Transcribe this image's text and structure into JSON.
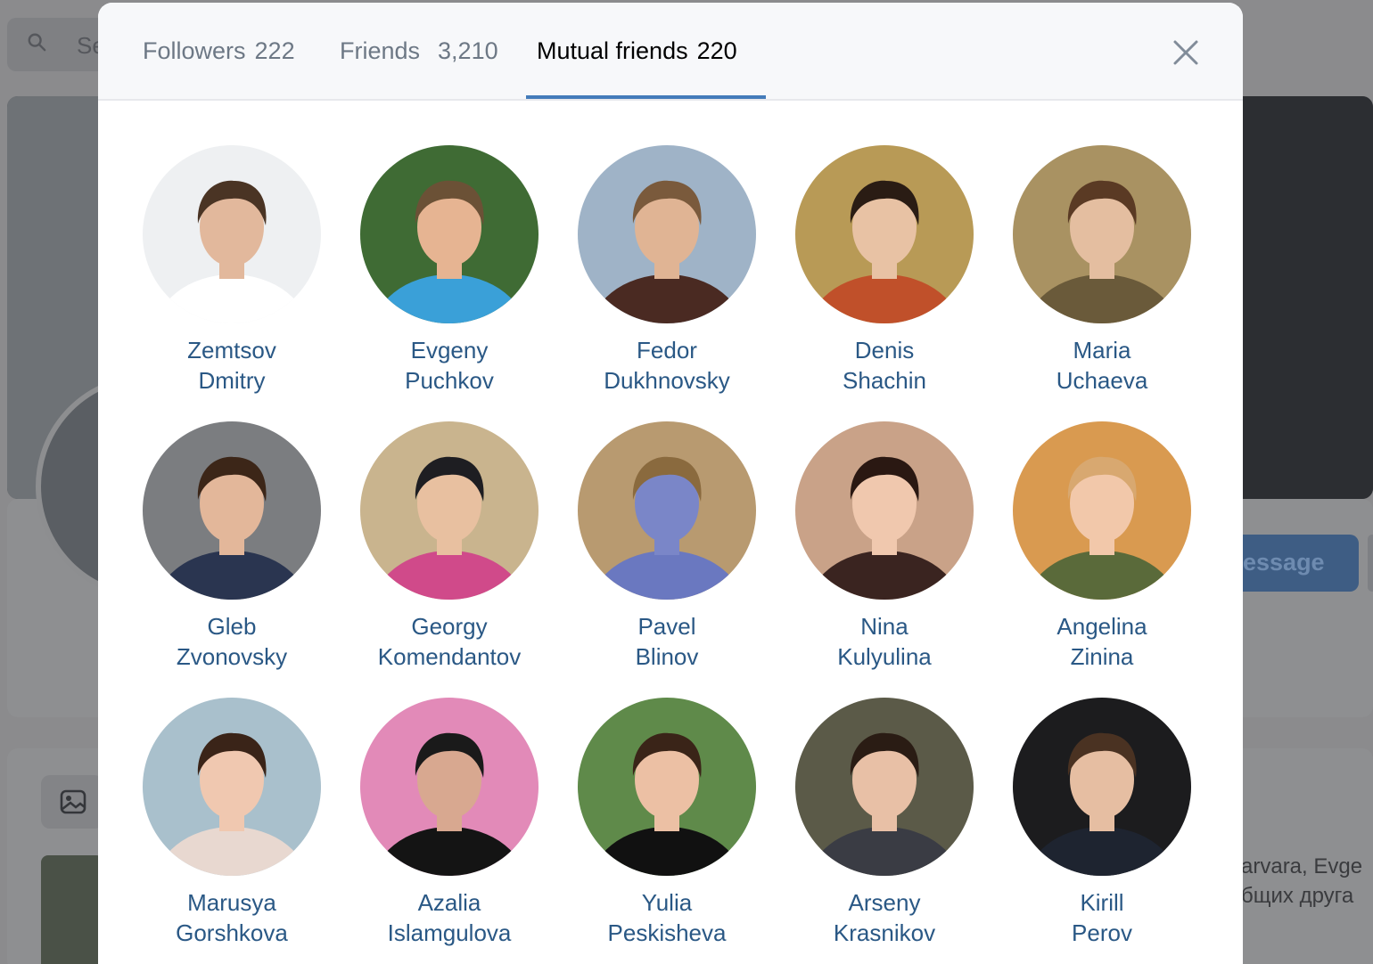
{
  "background": {
    "search_placeholder": "Se",
    "message_label": "essage",
    "mutual_line1": "arvara, Evge",
    "mutual_line2": "бщих друга"
  },
  "tabs": [
    {
      "label": "Followers",
      "count": "222",
      "active": false
    },
    {
      "label": "Friends",
      "count": "3,210",
      "active": false
    },
    {
      "label": "Mutual friends",
      "count": "220",
      "active": true
    }
  ],
  "colors": {
    "accent": "#447bba",
    "link": "#2a5885",
    "inactive_tab": "#6d7885"
  },
  "friends": [
    {
      "first": "Zemtsov",
      "last": "Dmitry",
      "bg": "#eef0f2",
      "skin": "#e2b89c",
      "hair": "#4a3424",
      "shirt": "#ffffff"
    },
    {
      "first": "Evgeny",
      "last": "Puchkov",
      "bg": "#3f6b34",
      "skin": "#e6b492",
      "hair": "#6b5136",
      "shirt": "#3aa0d8"
    },
    {
      "first": "Fedor",
      "last": "Dukhnovsky",
      "bg": "#9fb3c7",
      "skin": "#e0b494",
      "hair": "#7a5a3c",
      "shirt": "#4a2a22"
    },
    {
      "first": "Denis",
      "last": "Shachin",
      "bg": "#b89a56",
      "skin": "#e8c2a4",
      "hair": "#2a1c14",
      "shirt": "#c0502a"
    },
    {
      "first": "Maria",
      "last": "Uchaeva",
      "bg": "#a99262",
      "skin": "#e4bea0",
      "hair": "#5a3a24",
      "shirt": "#6a5a3a"
    },
    {
      "first": "Gleb",
      "last": "Zvonovsky",
      "bg": "#7b7d80",
      "skin": "#e3b79a",
      "hair": "#3c2618",
      "shirt": "#2a3550"
    },
    {
      "first": "Georgy",
      "last": "Komendantov",
      "bg": "#c9b48e",
      "skin": "#e8c0a0",
      "hair": "#1e1e22",
      "shirt": "#d04a8a"
    },
    {
      "first": "Pavel",
      "last": "Blinov",
      "bg": "#b89a70",
      "skin": "#7a86c8",
      "hair": "#8a6a3e",
      "shirt": "#6a78c0"
    },
    {
      "first": "Nina",
      "last": "Kulyulina",
      "bg": "#c9a288",
      "skin": "#f0c8ae",
      "hair": "#2a1812",
      "shirt": "#3a2420"
    },
    {
      "first": "Angelina",
      "last": "Zinina",
      "bg": "#d99a50",
      "skin": "#f2c8aa",
      "hair": "#d8a870",
      "shirt": "#5a6a3a"
    },
    {
      "first": "Marusya",
      "last": "Gorshkova",
      "bg": "#a9c0cc",
      "skin": "#f0c8b0",
      "hair": "#3a2418",
      "shirt": "#e8d8d0"
    },
    {
      "first": "Azalia",
      "last": "Islamgulova",
      "bg": "#e28ab8",
      "skin": "#d8a890",
      "hair": "#1a1a1a",
      "shirt": "#141414"
    },
    {
      "first": "Yulia",
      "last": "Peskisheva",
      "bg": "#5f8a4a",
      "skin": "#ecc0a4",
      "hair": "#3a2418",
      "shirt": "#111111"
    },
    {
      "first": "Arseny",
      "last": "Krasnikov",
      "bg": "#5b5a48",
      "skin": "#e8c0a6",
      "hair": "#2a1c14",
      "shirt": "#3a3c44"
    },
    {
      "first": "Kirill",
      "last": "Perov",
      "bg": "#1c1c1e",
      "skin": "#e6bea2",
      "hair": "#4a3222",
      "shirt": "#1e2430"
    }
  ]
}
